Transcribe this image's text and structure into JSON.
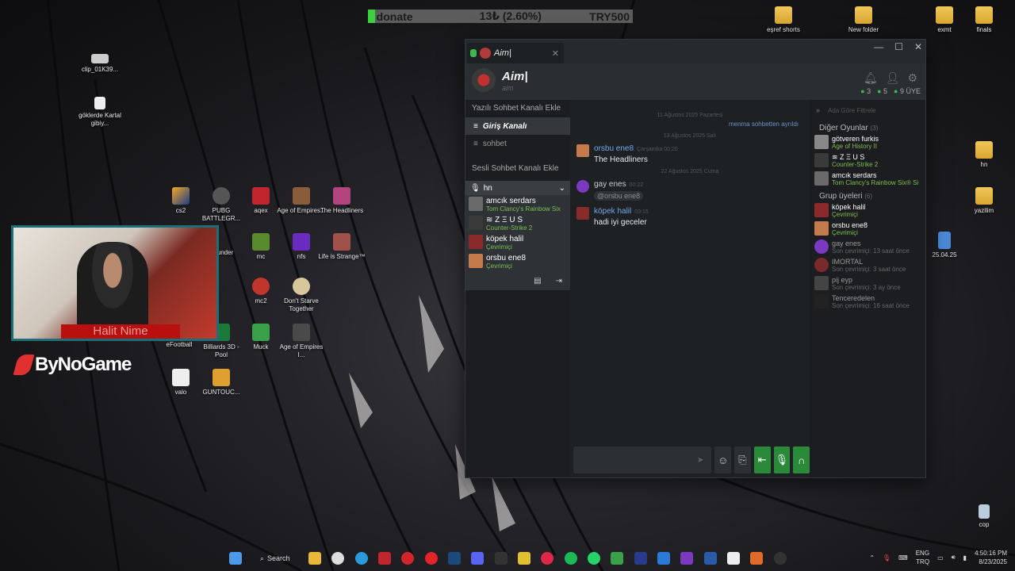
{
  "donate": {
    "label": "donate",
    "progress": "13₺ (2.60%)",
    "goal": "TRY500",
    "fraction": 0.026
  },
  "desktop_icons": {
    "clip": "clip_01K39...",
    "goklerde": "göklerde Kartal gibiy...",
    "cs2": "cs2",
    "pubg": "PUBG BATTLEGR...",
    "aqex": "aqex",
    "aoe": "Age of Empires...",
    "headliners": "The Headliners",
    "thunder": "under",
    "mc": "mc",
    "nfs": "nfs",
    "lis": "Life is Strange™",
    "mc2": "mc2",
    "dst": "Don't Starve Together",
    "efootball": "eFootball",
    "billiards": "Billiards 3D - Pool",
    "muck": "Muck",
    "aoe4": "Age of Empires I...",
    "valo": "valo",
    "guntouch": "GUNTOUC...",
    "esref": "eşref shorts",
    "newfolder": "New folder",
    "exmt": "exmt",
    "finals": "finals",
    "hn": "hn",
    "yazilim": "yazilim",
    "date_file": "25.04.25",
    "recycle": "cop"
  },
  "webcam": {
    "name": "Halit Nime"
  },
  "brand": {
    "name": "ByNoGame"
  },
  "app": {
    "tab_title": "Aim|",
    "server_title": "Aim|",
    "server_sub": "aim",
    "counts": {
      "a": "3",
      "b": "5",
      "members": "9 ÜYE"
    },
    "sidebar": {
      "text_section": "Yazılı Sohbet Kanalı Ekle",
      "channels": [
        "Giriş Kanalı",
        "sohbet"
      ],
      "voice_section": "Sesli Sohbet Kanalı Ekle",
      "voice_group": "hn",
      "voice_users": [
        {
          "name": "amcık serdars",
          "status": "Tom Clancy's Rainbow Six"
        },
        {
          "name": "≋ Z Ξ U S",
          "status": "Counter-Strike 2"
        },
        {
          "name": "köpek halil",
          "status": "Çevrimiçi"
        },
        {
          "name": "orsbu ene8",
          "status": "Çevrimiçi"
        }
      ]
    },
    "chat": {
      "day1": "11 Ağustos 2025 Pazartesi",
      "sys": "menma sohbetten ayrıldı",
      "day2": "13 Ağustos 2025 Salı",
      "m1_name": "orsbu ene8",
      "m1_time": "Çarşamba 00:20",
      "m1_text": "The Headliners",
      "day3": "22 Ağustos 2025 Cuma",
      "m2_name": "gay enes",
      "m2_time": "00:22",
      "m2_text": "@orsbu ene8",
      "m3_name": "köpek halil",
      "m3_time": "03:15",
      "m3_text": "hadi iyi geceler"
    },
    "members": {
      "filter_placeholder": "Ada Göre Filtrele",
      "group1": "Diğer Oyunlar",
      "group1_count": "(3)",
      "g1": [
        {
          "name": "götveren furkis",
          "status": "Age of History II"
        },
        {
          "name": "≋ Z Ξ U S",
          "status": "Counter-Strike 2"
        },
        {
          "name": "amcık serdars",
          "status": "Tom Clancy's Rainbow Six® Si"
        }
      ],
      "group2": "Grup üyeleri",
      "group2_count": "(6)",
      "g2": [
        {
          "name": "köpek halil",
          "status": "Çevrimiçi"
        },
        {
          "name": "orsbu ene8",
          "status": "Çevrimiçi"
        },
        {
          "name": "gay enes",
          "status": "Son çevrimiçi: 13 saat önce"
        },
        {
          "name": "IMORTAL",
          "status": "Son çevrimiçi: 3 saat önce"
        },
        {
          "name": "pij eyp",
          "status": "Son çevrimiçi: 3 ay önce"
        },
        {
          "name": "Tenceredelen",
          "status": "Son çevrimiçi: 16 saat önce"
        }
      ]
    }
  },
  "taskbar": {
    "search": "Search",
    "lang1": "ENG",
    "lang2": "TRQ",
    "time": "4:50:16 PM",
    "date": "8/23/2025"
  }
}
